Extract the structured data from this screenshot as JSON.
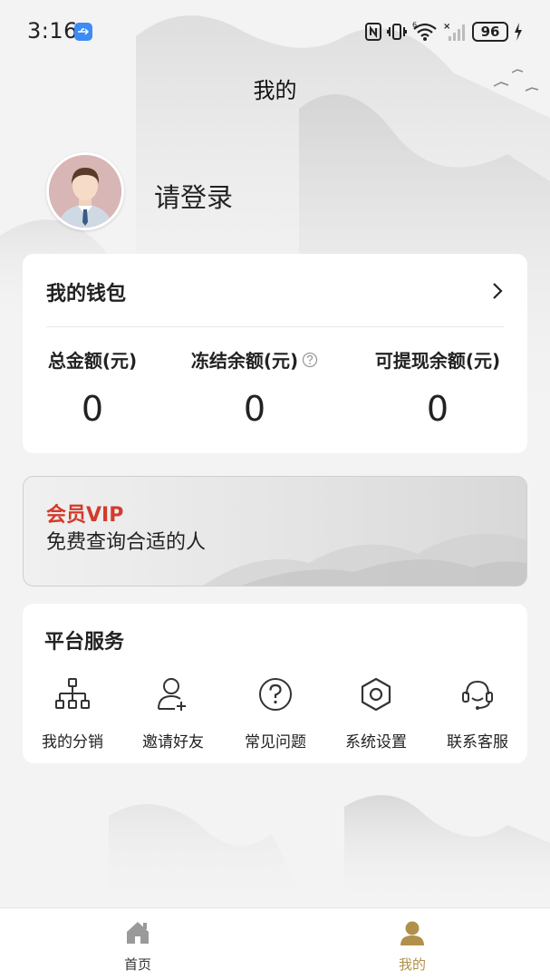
{
  "status_bar": {
    "time": "3:16",
    "battery": "96",
    "icons": [
      "usb-icon",
      "nfc-icon",
      "vibrate-icon",
      "wifi-icon",
      "signal-icon",
      "battery-icon",
      "charging-icon"
    ]
  },
  "page": {
    "title": "我的"
  },
  "profile": {
    "login_prompt": "请登录",
    "avatar_icon": "user-avatar-icon"
  },
  "wallet": {
    "title": "我的钱包",
    "columns": [
      {
        "label": "总金额(元)",
        "value": "0"
      },
      {
        "label": "冻结余额(元)",
        "value": "0",
        "icon": "help-circle-icon"
      },
      {
        "label": "可提现余额(元)",
        "value": "0"
      }
    ]
  },
  "vip": {
    "title": "会员VIP",
    "subtitle": "免费查询合适的人"
  },
  "services": {
    "title": "平台服务",
    "items": [
      {
        "label": "我的分销",
        "icon": "org-chart-icon"
      },
      {
        "label": "邀请好友",
        "icon": "add-user-icon"
      },
      {
        "label": "常见问题",
        "icon": "question-circle-icon"
      },
      {
        "label": "系统设置",
        "icon": "settings-hexagon-icon"
      },
      {
        "label": "联系客服",
        "icon": "headset-icon"
      }
    ]
  },
  "tabbar": {
    "items": [
      {
        "label": "首页",
        "icon": "home-icon",
        "active": false
      },
      {
        "label": "我的",
        "icon": "user-icon",
        "active": true
      }
    ]
  },
  "colors": {
    "vip_title": "#d33a2c",
    "tab_active": "#b0904a",
    "tab_inactive": "#9a9a9a",
    "accent_blue": "#3d8bf5"
  }
}
